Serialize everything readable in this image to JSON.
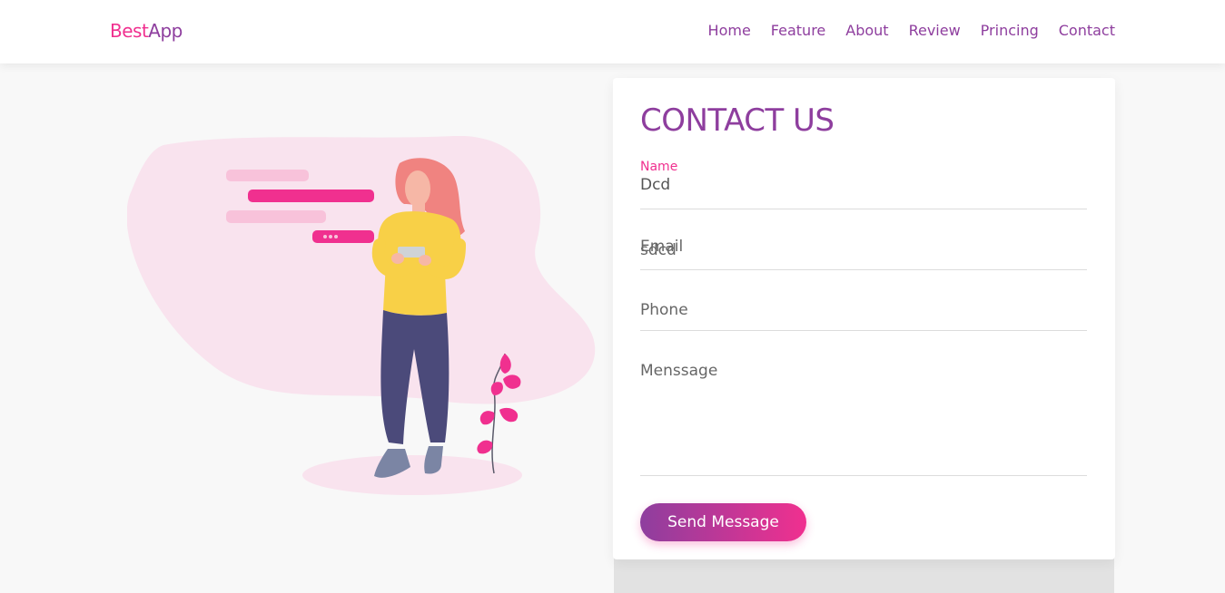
{
  "brand": {
    "part1": "Best",
    "part2": "App"
  },
  "nav": [
    "Home",
    "Feature",
    "About",
    "Review",
    "Princing",
    "Contact"
  ],
  "contact": {
    "title": "CONTACT US",
    "name_label": "Name",
    "name_value": "Dcd",
    "email_label": "Email",
    "email_value": "sdcd",
    "phone_placeholder": "Phone",
    "message_placeholder": "Menssage",
    "submit_label": "Send Message"
  },
  "colors": {
    "accent_pink": "#f0308f",
    "accent_purple": "#8e3e9e",
    "blob": "#f9e3ee"
  }
}
